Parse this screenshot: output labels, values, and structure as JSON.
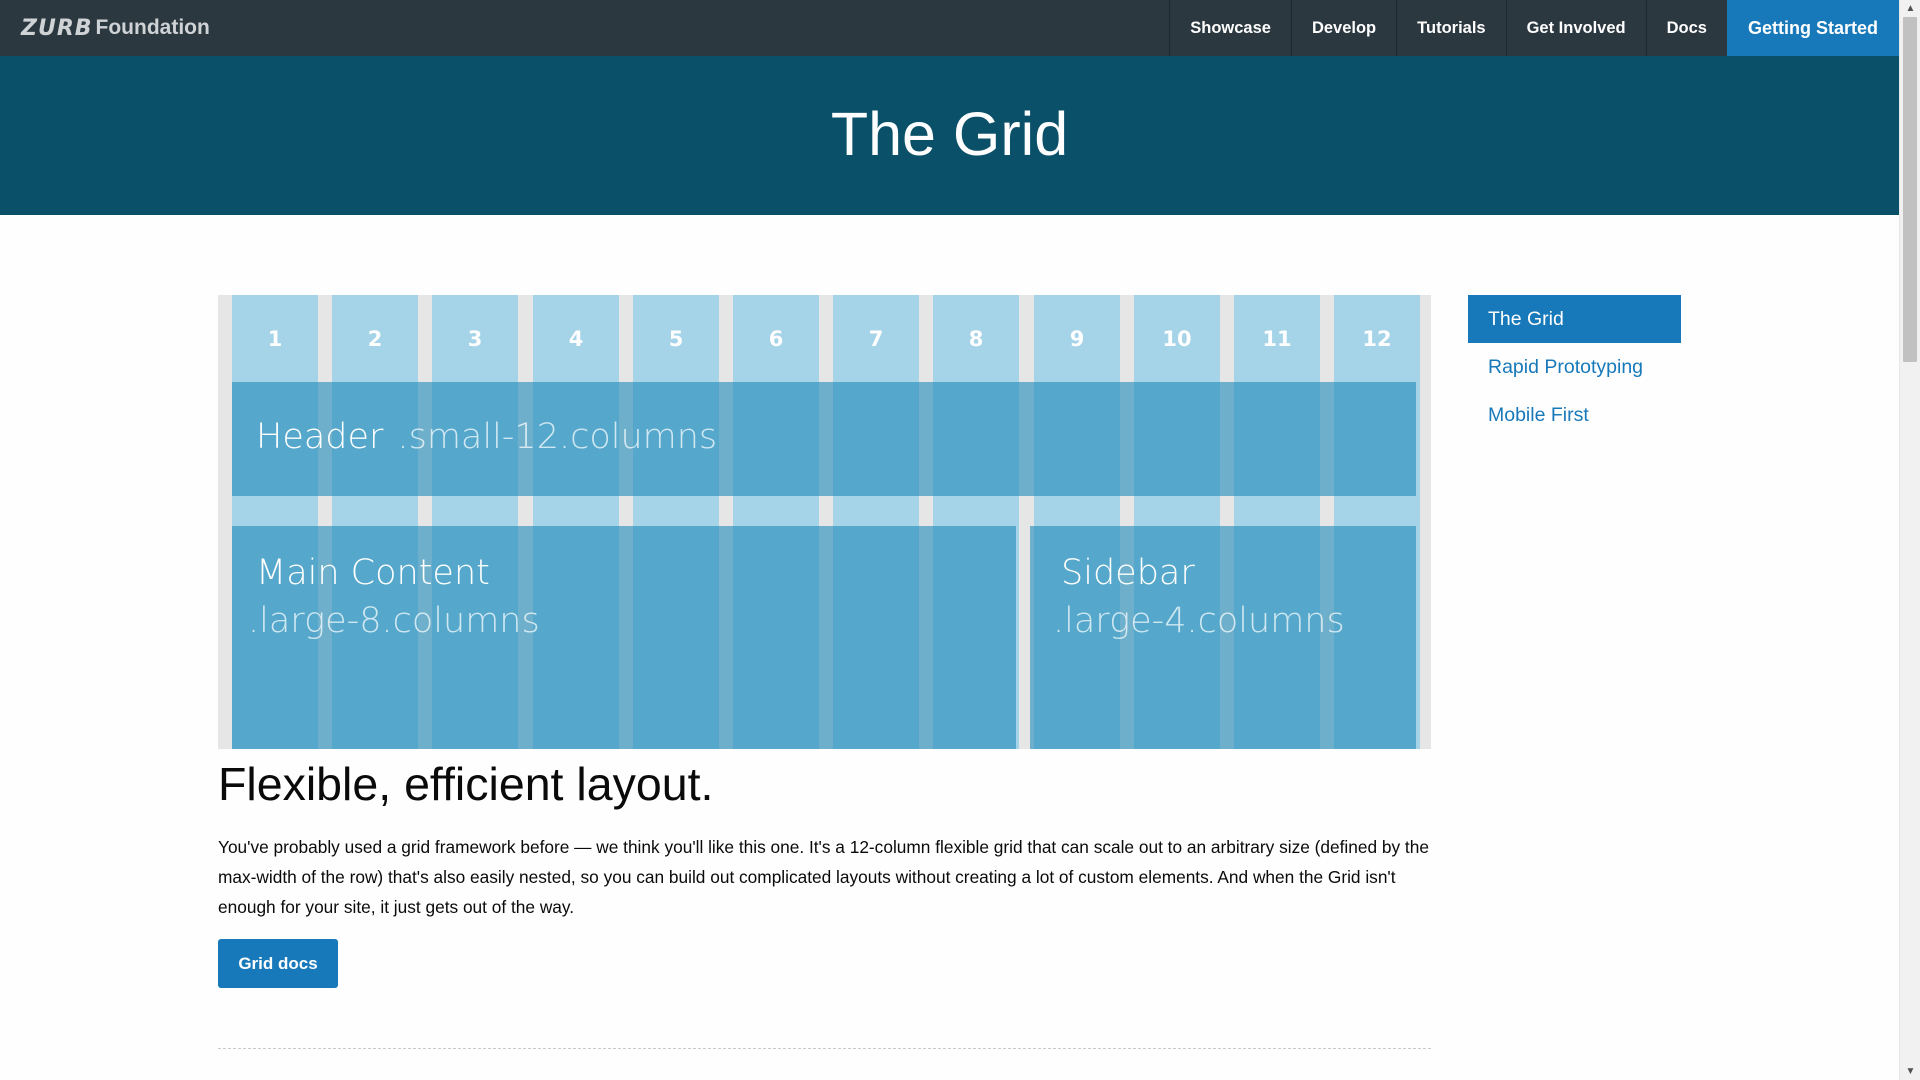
{
  "topbar": {
    "brand_mark": "ZURB",
    "brand_name": "Foundation",
    "nav": [
      "Showcase",
      "Develop",
      "Tutorials",
      "Get Involved",
      "Docs"
    ],
    "cta": "Getting Started"
  },
  "hero": {
    "title": "The Grid"
  },
  "grid_demo": {
    "columns": [
      "1",
      "2",
      "3",
      "4",
      "5",
      "6",
      "7",
      "8",
      "9",
      "10",
      "11",
      "12"
    ],
    "header_label": "Header",
    "header_class": ".small-12.columns",
    "main_label": "Main Content",
    "main_class": ".large-8.columns",
    "sidebar_label": "Sidebar",
    "sidebar_class": ".large-4.columns"
  },
  "content": {
    "headline": "Flexible, efficient layout.",
    "paragraph": "You've probably used a grid framework before — we think you'll like this one. It's a 12-column flexible grid that can scale out to an arbitrary size (defined by the max-width of the row) that's also easily nested, so you can build out complicated layouts without creating a lot of custom elements. And when the Grid isn't enough for your site, it just gets out of the way.",
    "button_label": "Grid docs"
  },
  "sidenav": {
    "items": [
      "The Grid",
      "Rapid Prototyping",
      "Mobile First"
    ],
    "active": "The Grid"
  },
  "colors": {
    "topbar": "#2c3840",
    "hero": "#0b5069",
    "primary": "#1779ba",
    "column_light": "#a5d3e8",
    "block": "#4fa8c8"
  }
}
